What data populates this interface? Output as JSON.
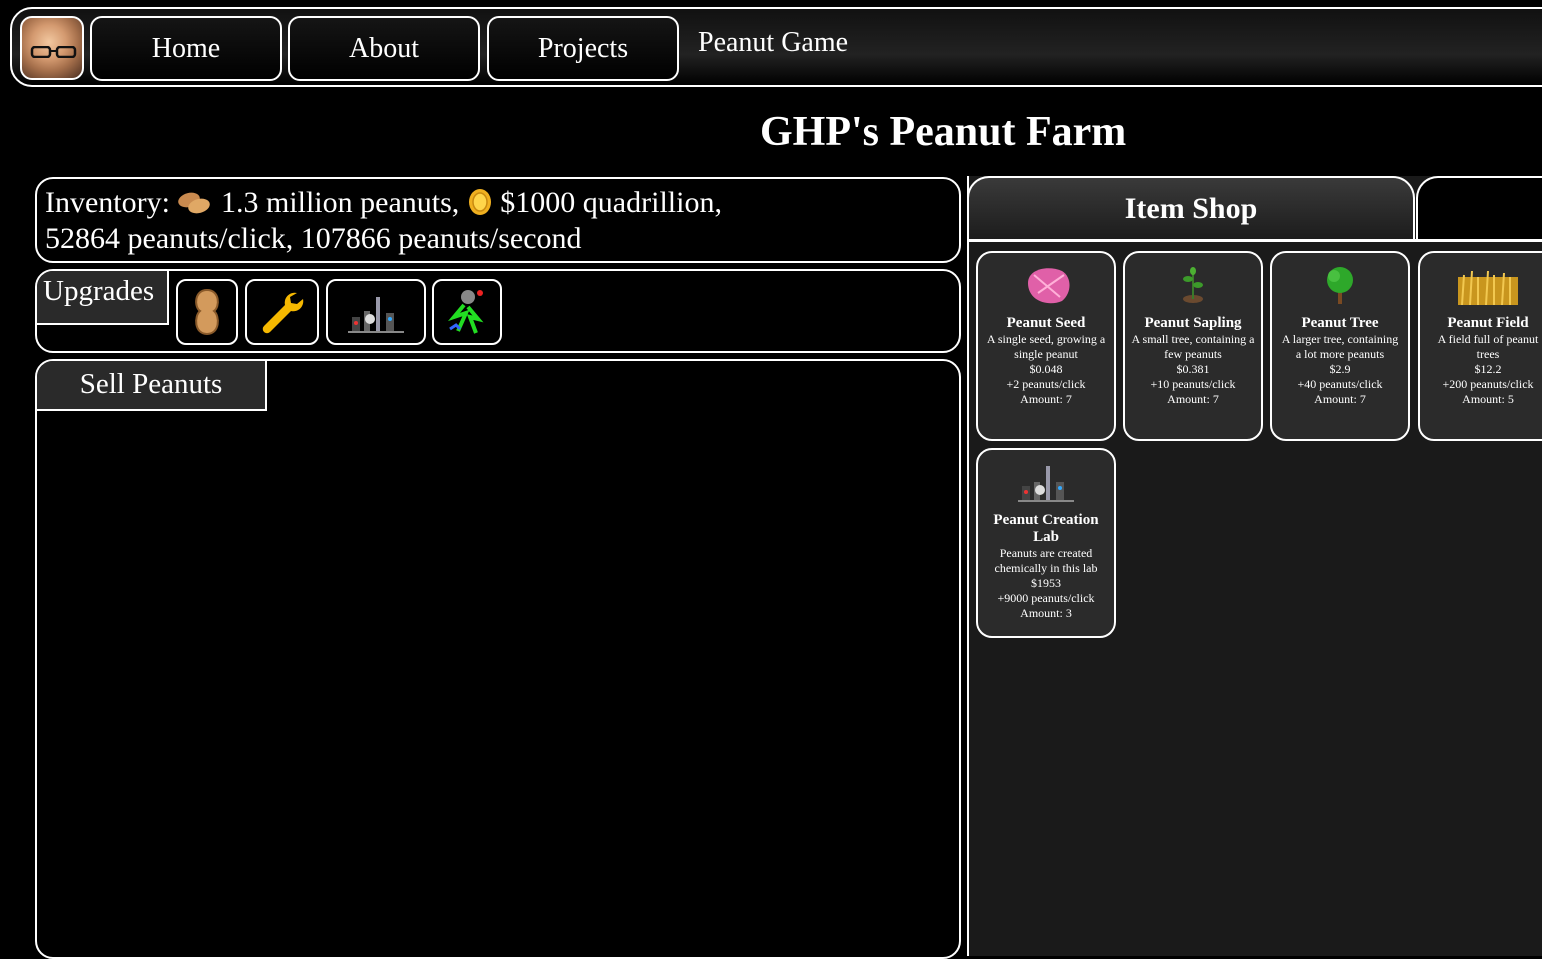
{
  "nav": {
    "items": [
      {
        "label": "Home"
      },
      {
        "label": "About"
      },
      {
        "label": "Projects"
      }
    ],
    "title": "Peanut Game"
  },
  "page_title": "GHP's Peanut Farm",
  "inventory": {
    "prefix": "Inventory:",
    "peanuts": "1.3 million peanuts,",
    "money": "$1000 quadrillion,",
    "rates": "52864 peanuts/click, 107866 peanuts/second"
  },
  "upgrades": {
    "label": "Upgrades",
    "icons": [
      "peanut-upgrade-icon",
      "wrench-upgrade-icon",
      "lab-upgrade-icon",
      "robot-upgrade-icon"
    ]
  },
  "sell": {
    "label": "Sell Peanuts"
  },
  "shop": {
    "tabs": [
      {
        "label": "Item Shop"
      },
      {
        "label": ""
      }
    ],
    "items": [
      {
        "name": "Peanut Seed",
        "desc": "A single seed, growing a single peanut",
        "price": "$0.048",
        "rate": "+2 peanuts/click",
        "amount": "Amount: 7",
        "icon": "seed-icon"
      },
      {
        "name": "Peanut Sapling",
        "desc": "A small tree, containing a few peanuts",
        "price": "$0.381",
        "rate": "+10 peanuts/click",
        "amount": "Amount: 7",
        "icon": "sapling-icon"
      },
      {
        "name": "Peanut Tree",
        "desc": "A larger tree, containing a lot more peanuts",
        "price": "$2.9",
        "rate": "+40 peanuts/click",
        "amount": "Amount: 7",
        "icon": "tree-icon"
      },
      {
        "name": "Peanut Field",
        "desc": "A field full of peanut trees",
        "price": "$12.2",
        "rate": "+200 peanuts/click",
        "amount": "Amount: 5",
        "icon": "field-icon"
      },
      {
        "name": "Peanut Creation Lab",
        "desc": "Peanuts are created chemically in this lab",
        "price": "$1953",
        "rate": "+9000 peanuts/click",
        "amount": "Amount: 3",
        "icon": "lab-icon"
      }
    ]
  },
  "colors": {
    "background": "#000000",
    "panel_border": "#ffffff",
    "card_bg": "#2b2b2b",
    "shop_bg": "#1a1a1a"
  }
}
